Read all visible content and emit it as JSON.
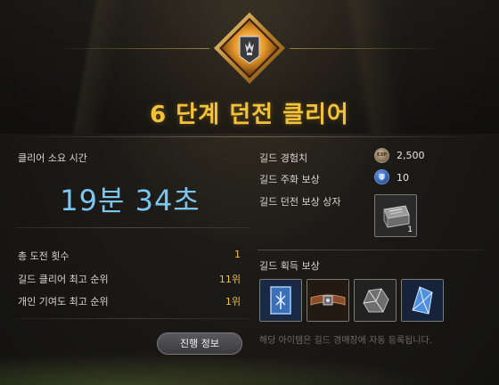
{
  "title": "6 단계 던전 클리어",
  "left": {
    "clear_time_label": "클리어 소요 시간",
    "clear_time_value": "19분 34초",
    "stats": [
      {
        "label": "총 도전 횟수",
        "value": "1"
      },
      {
        "label": "길드 클리어 최고 순위",
        "value": "11위"
      },
      {
        "label": "개인 기여도 최고 순위",
        "value": "1위"
      }
    ],
    "progress_button": "진행 정보"
  },
  "right": {
    "guild_exp_label": "길드 경험치",
    "guild_exp_value": "2,500",
    "guild_exp_icon_text": "EXP",
    "guild_coin_label": "길드 주화 보상",
    "guild_coin_value": "10",
    "guild_box_label": "길드 던전 보상 상자",
    "guild_box_qty": "1",
    "guild_rewards_label": "길드 획득 보상",
    "reward_items": [
      "blue-rune-scroll-icon",
      "brown-belt-icon",
      "grey-ore-icon",
      "blue-crystal-icon"
    ],
    "note": "해당 아이템은 길드 경매장에 자동 등록됩니다."
  },
  "colors": {
    "title": "#f4c23a",
    "time": "#7cc6f2",
    "value_yellow": "#f0c040"
  }
}
